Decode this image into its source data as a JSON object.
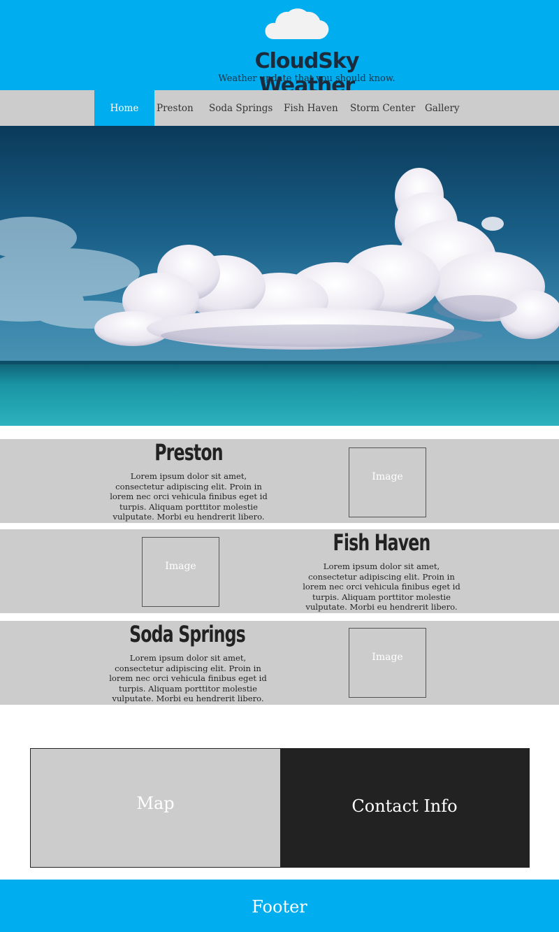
{
  "header": {
    "title": "CloudSky Weather",
    "tagline": "Weather update that you should know.",
    "logo_icon": "cloud-icon",
    "bg_color": "#00adee"
  },
  "nav": {
    "items": [
      {
        "label": "Home",
        "active": true
      },
      {
        "label": "Preston",
        "active": false
      },
      {
        "label": "Soda Springs",
        "active": false
      },
      {
        "label": "Fish Haven",
        "active": false
      },
      {
        "label": "Storm Center",
        "active": false
      },
      {
        "label": "Gallery",
        "active": false
      }
    ]
  },
  "towns": [
    {
      "name": "Preston",
      "text": "Lorem ipsum dolor sit amet, consectetur adipiscing elit. Proin in lorem nec orci vehicula finibus eget id turpis. Aliquam porttitor molestie vulputate. Morbi eu hendrerit libero.",
      "image_label": "Image"
    },
    {
      "name": "Fish Haven",
      "text": "Lorem ipsum dolor sit amet, consectetur adipiscing elit. Proin in lorem nec orci vehicula finibus eget id turpis. Aliquam porttitor molestie vulputate. Morbi eu hendrerit libero.",
      "image_label": "Image"
    },
    {
      "name": "Soda Springs",
      "text": "Lorem ipsum dolor sit amet, consectetur adipiscing elit. Proin in lorem nec orci vehicula finibus eget id turpis. Aliquam porttitor molestie vulputate. Morbi eu hendrerit libero.",
      "image_label": "Image"
    }
  ],
  "map": {
    "label": "Map"
  },
  "contact": {
    "label": "Contact Info"
  },
  "footer": {
    "label": "Footer"
  }
}
